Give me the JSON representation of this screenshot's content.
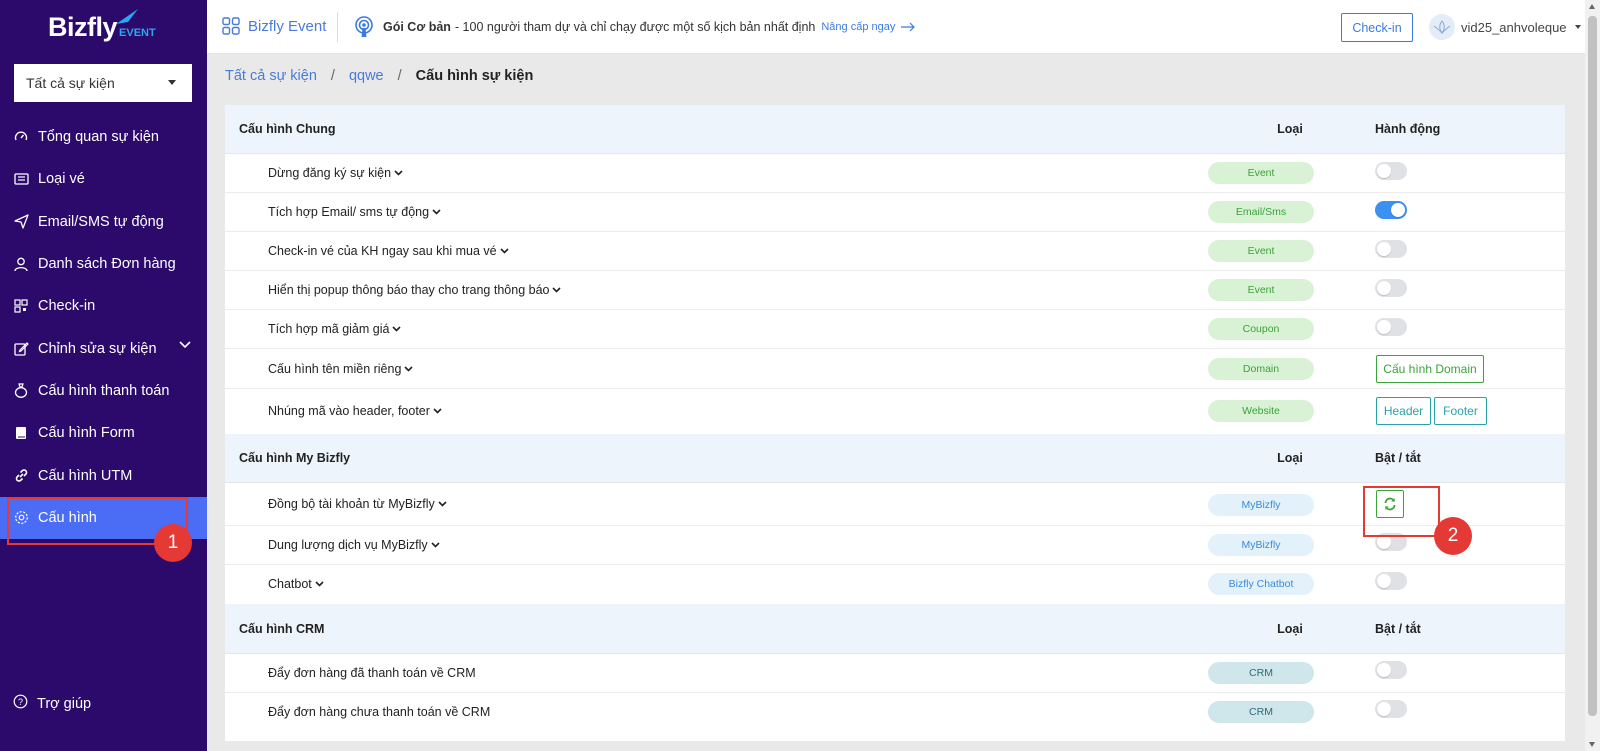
{
  "sidebar": {
    "logo_main": "Bizfly",
    "logo_sub": "EVENT",
    "event_select": "Tất cả sự kiện",
    "items": [
      {
        "label": "Tổng quan sự kiện",
        "icon": "gauge-icon"
      },
      {
        "label": "Loại vé",
        "icon": "ticket-icon"
      },
      {
        "label": "Email/SMS tự động",
        "icon": "send-icon"
      },
      {
        "label": "Danh sách Đơn hàng",
        "icon": "user-icon"
      },
      {
        "label": "Check-in",
        "icon": "qrcode-icon"
      },
      {
        "label": "Chỉnh sửa sự kiện",
        "icon": "edit-icon"
      },
      {
        "label": "Cấu hình thanh toán",
        "icon": "moneybag-icon"
      },
      {
        "label": "Cấu hình Form",
        "icon": "book-icon"
      },
      {
        "label": "Cấu hình UTM",
        "icon": "link-icon"
      },
      {
        "label": "Cấu hình",
        "icon": "gear-icon",
        "active": true
      }
    ],
    "help": "Trợ giúp"
  },
  "header": {
    "brand": "Bizfly Event",
    "plan_name": "Gói Cơ bản",
    "plan_desc": "- 100 người tham dự và chỉ chạy được một số kịch bản nhất định",
    "upgrade": "Nâng cấp ngay",
    "checkin": "Check-in",
    "username": "vid25_anhvoleque"
  },
  "breadcrumb": {
    "root": "Tất cả sự kiện",
    "event": "qqwe",
    "current": "Cấu hình sự kiện",
    "separator": "/"
  },
  "sections": {
    "general": {
      "title": "Cấu hình Chung",
      "col_type": "Loại",
      "col_action": "Hành động",
      "rows": [
        {
          "label": "Dừng đăng ký sự kiện",
          "type": "Event",
          "toggle": false
        },
        {
          "label": "Tích hợp Email/ sms tự động",
          "type": "Email/Sms",
          "toggle": true
        },
        {
          "label": "Check-in vé của KH ngay sau khi mua vé",
          "type": "Event",
          "toggle": false
        },
        {
          "label": "Hiển thị popup thông báo thay cho trang thông báo",
          "type": "Event",
          "toggle": false
        },
        {
          "label": "Tích hợp mã giảm giá",
          "type": "Coupon",
          "toggle": false
        },
        {
          "label": "Cấu hình tên miền riêng",
          "type": "Domain",
          "button": "Cấu hình Domain"
        },
        {
          "label": "Nhúng mã vào header, footer",
          "type": "Website",
          "buttons": [
            "Header",
            "Footer"
          ]
        }
      ]
    },
    "mybizfly": {
      "title": "Cấu hình My Bizfly",
      "col_type": "Loại",
      "col_action": "Bật / tắt",
      "rows": [
        {
          "label": "Đồng bộ tài khoản từ MyBizfly",
          "type": "MyBizfly",
          "action": "sync"
        },
        {
          "label": "Dung lượng dịch vụ MyBizfly",
          "type": "MyBizfly",
          "toggle": false
        },
        {
          "label": "Chatbot",
          "type": "Bizfly Chatbot",
          "toggle": false
        }
      ]
    },
    "crm": {
      "title": "Cấu hình CRM",
      "col_type": "Loại",
      "col_action": "Bật / tắt",
      "rows": [
        {
          "label": "Đẩy đơn hàng đã thanh toán về CRM",
          "type": "CRM",
          "toggle": false
        },
        {
          "label": "Đẩy đơn hàng chưa thanh toán về CRM",
          "type": "CRM",
          "toggle": false
        }
      ]
    }
  },
  "annotations": {
    "marker1": "1",
    "marker2": "2",
    "color": "#e53935"
  },
  "colors": {
    "sidebar_bg": "#2b0a6b",
    "active_item": "#4b6cf4",
    "link": "#4a7bd8",
    "toggle_on": "#3d8ff0"
  }
}
